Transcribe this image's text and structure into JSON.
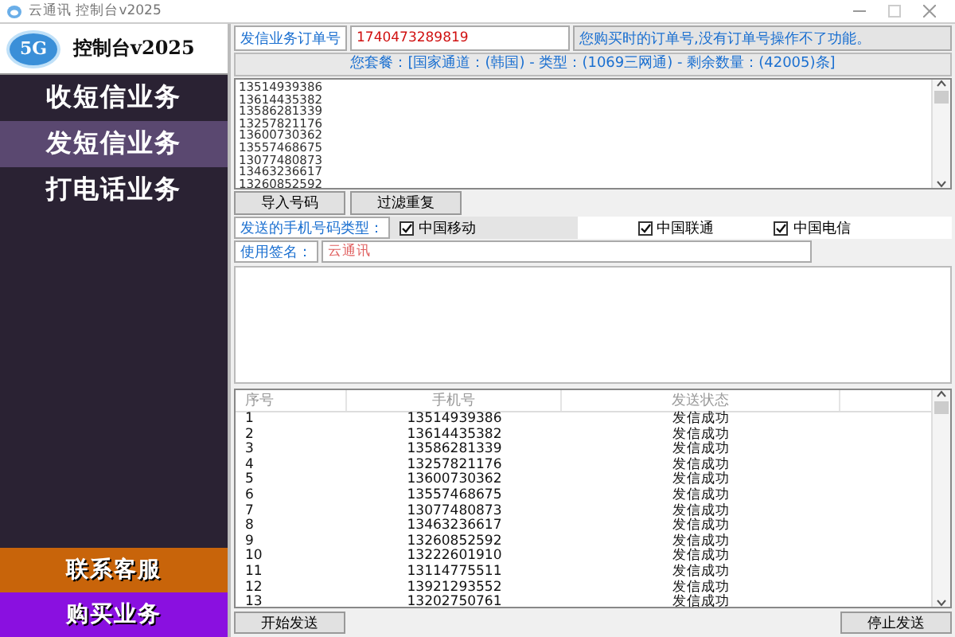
{
  "window": {
    "title": "云通讯 控制台v2025"
  },
  "sidebar": {
    "logo_badge": "5G",
    "logo_text": "控制台v2025",
    "items": [
      {
        "label": "收短信业务",
        "selected": false
      },
      {
        "label": "发短信业务",
        "selected": true
      },
      {
        "label": "打电话业务",
        "selected": false
      }
    ],
    "bottom_buttons": [
      {
        "label": "联系客服",
        "color": "#c8640a"
      },
      {
        "label": "购买业务",
        "color": "#8a10e0"
      }
    ]
  },
  "order": {
    "label": "发信业务订单号",
    "value": "1740473289819",
    "hint": "您购买时的订单号,没有订单号操作不了功能。"
  },
  "package_info": "您套餐：[国家通道：(韩国) - 类型：(1069三网通) - 剩余数量：(42005)条]",
  "numbers_box": {
    "value": "13514939386\n13614435382\n13586281339\n13257821176\n13600730362\n13557468675\n13077480873\n13463236617\n13260852592"
  },
  "buttons": [
    "导入号码",
    "过滤重复"
  ],
  "carrier_filter": {
    "label": "发送的手机号码类型：",
    "options": [
      {
        "label": "中国移动",
        "checked": true
      },
      {
        "label": "中国联通",
        "checked": true
      },
      {
        "label": "中国电信",
        "checked": true
      }
    ]
  },
  "signature": {
    "label": "使用签名：",
    "value": "云通讯"
  },
  "table": {
    "columns": [
      "序号",
      "手机号",
      "发送状态"
    ],
    "rows": [
      [
        "1",
        "13514939386",
        "发信成功"
      ],
      [
        "2",
        "13614435382",
        "发信成功"
      ],
      [
        "3",
        "13586281339",
        "发信成功"
      ],
      [
        "4",
        "13257821176",
        "发信成功"
      ],
      [
        "5",
        "13600730362",
        "发信成功"
      ],
      [
        "6",
        "13557468675",
        "发信成功"
      ],
      [
        "7",
        "13077480873",
        "发信成功"
      ],
      [
        "8",
        "13463236617",
        "发信成功"
      ],
      [
        "9",
        "13260852592",
        "发信成功"
      ],
      [
        "10",
        "13222601910",
        "发信成功"
      ],
      [
        "11",
        "13114775511",
        "发信成功"
      ],
      [
        "12",
        "13921293552",
        "发信成功"
      ],
      [
        "13",
        "13202750761",
        "发信成功"
      ]
    ]
  },
  "actions": [
    "开始发送",
    "停止发送"
  ]
}
